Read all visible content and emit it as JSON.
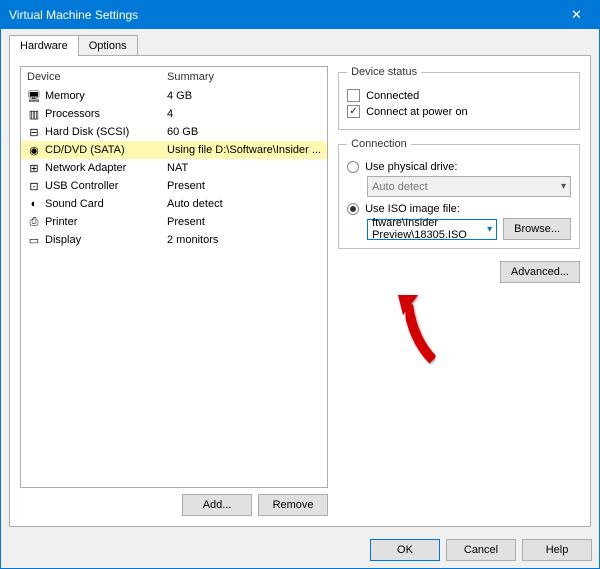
{
  "window": {
    "title": "Virtual Machine Settings",
    "close_glyph": "✕"
  },
  "tabs": {
    "hardware": "Hardware",
    "options": "Options"
  },
  "headers": {
    "device": "Device",
    "summary": "Summary"
  },
  "devices": [
    {
      "icon": "🖥",
      "name": "Memory",
      "summary": "4 GB"
    },
    {
      "icon": "▥",
      "name": "Processors",
      "summary": "4"
    },
    {
      "icon": "⊟",
      "name": "Hard Disk (SCSI)",
      "summary": "60 GB"
    },
    {
      "icon": "◉",
      "name": "CD/DVD (SATA)",
      "summary": "Using file D:\\Software\\Insider ..."
    },
    {
      "icon": "⊞",
      "name": "Network Adapter",
      "summary": "NAT"
    },
    {
      "icon": "⊡",
      "name": "USB Controller",
      "summary": "Present"
    },
    {
      "icon": "◐",
      "name": "Sound Card",
      "summary": "Auto detect"
    },
    {
      "icon": "⎙",
      "name": "Printer",
      "summary": "Present"
    },
    {
      "icon": "▭",
      "name": "Display",
      "summary": "2 monitors"
    }
  ],
  "left_buttons": {
    "add": "Add...",
    "remove": "Remove"
  },
  "device_status": {
    "legend": "Device status",
    "connected": "Connected",
    "connect_power": "Connect at power on"
  },
  "connection": {
    "legend": "Connection",
    "physical": "Use physical drive:",
    "auto_detect": "Auto detect",
    "use_iso": "Use ISO image file:",
    "iso_value": "ftware\\Insider Preview\\18305.ISO",
    "browse": "Browse..."
  },
  "advanced": "Advanced...",
  "dialog": {
    "ok": "OK",
    "cancel": "Cancel",
    "help": "Help"
  },
  "chev": "▾",
  "check": "✓"
}
